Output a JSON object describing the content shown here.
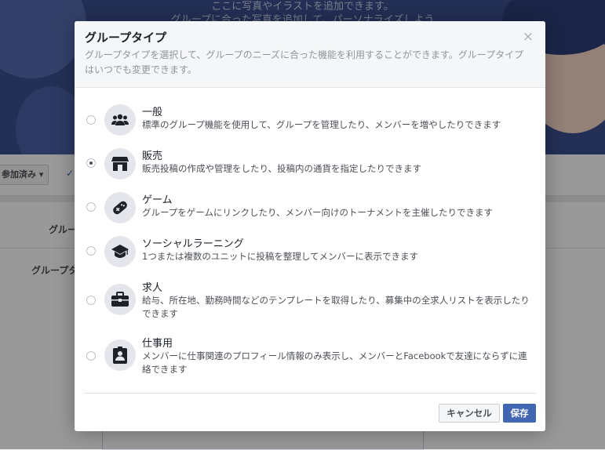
{
  "background": {
    "cover_line1": "ここに写真やイラストを追加できます。",
    "cover_line2": "グループに合った写真を追加して、パーソナライズしよう",
    "joined_button": "参加済み ▾",
    "label_group_name": "グルー",
    "label_group_type": "グループタ"
  },
  "dialog": {
    "title": "グループタイプ",
    "close": "×",
    "subtitle": "グループタイプを選択して、グループのニーズに合った機能を利用することができます。グループタイプはいつでも変更できます。",
    "options": [
      {
        "title": "一般",
        "desc": "標準のグループ機能を使用して、グループを管理したり、メンバーを増やしたりできます",
        "icon": "people-icon",
        "selected": false
      },
      {
        "title": "販売",
        "desc": "販売投稿の作成や管理をしたり、投稿内の通貨を指定したりできます",
        "icon": "shop-icon",
        "selected": true
      },
      {
        "title": "ゲーム",
        "desc": "グループをゲームにリンクしたり、メンバー向けのトーナメントを主催したりできます",
        "icon": "gamepad-icon",
        "selected": false
      },
      {
        "title": "ソーシャルラーニング",
        "desc": "1つまたは複数のユニットに投稿を整理してメンバーに表示できます",
        "icon": "graduation-cap-icon",
        "selected": false
      },
      {
        "title": "求人",
        "desc": "給与、所在地、勤務時間などのテンプレートを取得したり、募集中の全求人リストを表示したりできます",
        "icon": "briefcase-icon",
        "selected": false
      },
      {
        "title": "仕事用",
        "desc": "メンバーに仕事関連のプロフィール情報のみ表示し、メンバーとFacebookで友達にならずに連絡できます",
        "icon": "id-badge-icon",
        "selected": false
      }
    ],
    "cancel_label": "キャンセル",
    "save_label": "保存"
  }
}
